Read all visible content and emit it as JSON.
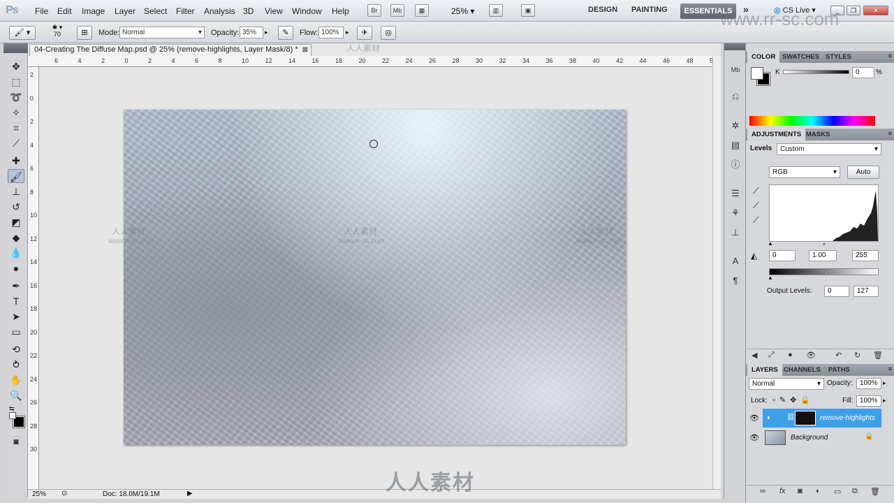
{
  "menubar": {
    "logo": "Ps",
    "items": [
      "File",
      "Edit",
      "Image",
      "Layer",
      "Select",
      "Filter",
      "Analysis",
      "3D",
      "View",
      "Window",
      "Help"
    ],
    "bridge": "Br",
    "minibridge": "Mb",
    "zoom": "25%",
    "workspaces": {
      "design": "DESIGN",
      "painting": "PAINTING",
      "essentials": "ESSENTIALS",
      "more": "»"
    },
    "cslive": "CS Live"
  },
  "options": {
    "brush_size": "70",
    "mode_label": "Mode:",
    "mode_value": "Normal",
    "opacity_label": "Opacity:",
    "opacity_value": "35%",
    "flow_label": "Flow:",
    "flow_value": "100%"
  },
  "document": {
    "tab_title": "04-Creating The Diffuse Map.psd @ 25% (remove-highlights, Layer Mask/8) *",
    "ruler_h": [
      "6",
      "4",
      "2",
      "0",
      "2",
      "4",
      "6",
      "8",
      "10",
      "12",
      "14",
      "16",
      "18",
      "20",
      "22",
      "24",
      "26",
      "28",
      "30",
      "32",
      "34",
      "36",
      "38",
      "40",
      "42",
      "44",
      "46",
      "48",
      "50"
    ],
    "ruler_v": [
      "2",
      "0",
      "2",
      "4",
      "6",
      "8",
      "10",
      "12",
      "14",
      "16",
      "18",
      "20",
      "22",
      "24",
      "26",
      "28",
      "30"
    ],
    "status_zoom": "25%",
    "status_doc": "Doc: 18.0M/19.1M"
  },
  "color_panel": {
    "tabs": [
      "COLOR",
      "SWATCHES",
      "STYLES"
    ],
    "k_label": "K",
    "k_value": "0",
    "k_unit": "%"
  },
  "adjustments_panel": {
    "tabs": [
      "ADJUSTMENTS",
      "MASKS"
    ],
    "title": "Levels",
    "preset": "Custom",
    "channel": "RGB",
    "auto": "Auto",
    "input_black": "0",
    "input_gamma": "1.00",
    "input_white": "255",
    "output_label": "Output Levels:",
    "output_black": "0",
    "output_white": "127"
  },
  "layers_panel": {
    "tabs": [
      "LAYERS",
      "CHANNELS",
      "PATHS"
    ],
    "blend": "Normal",
    "opacity_label": "Opacity:",
    "opacity_value": "100%",
    "lock_label": "Lock:",
    "fill_label": "Fill:",
    "fill_value": "100%",
    "layers": [
      {
        "name": "remove-highlights",
        "selected": true
      },
      {
        "name": "Background",
        "selected": false
      }
    ]
  },
  "watermark": {
    "cn": "人人素材",
    "url": "www.rr-sc.com"
  },
  "colors": {
    "accent": "#4ea8e6",
    "selection": "#3f9fe8"
  }
}
